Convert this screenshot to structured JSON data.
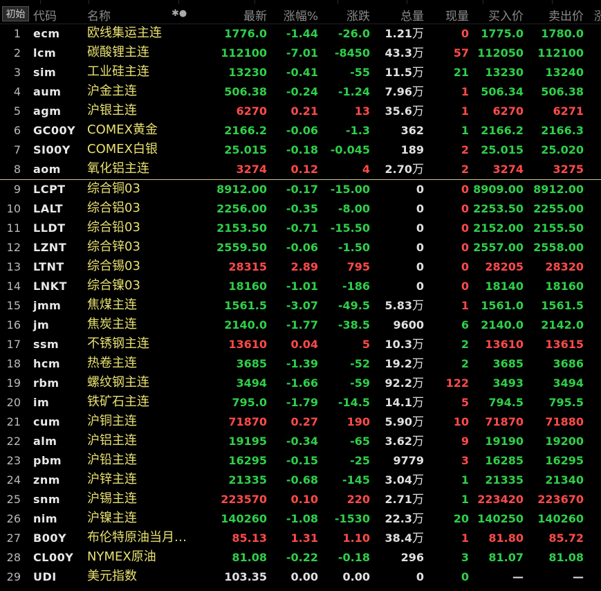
{
  "header": {
    "reset": "初始",
    "code": "代码",
    "name": "名称",
    "settings": "✱●",
    "last": "最新",
    "pct": "涨幅%",
    "chg": "涨跌",
    "vol": "总量",
    "cur": "现量",
    "bid": "买入价",
    "ask": "卖出价",
    "more": "涨"
  },
  "rows": [
    {
      "idx": "1",
      "code": "ecm",
      "name": "欧线集运主连",
      "last": "1776.0",
      "pct": "-1.44",
      "chg": "-26.0",
      "vol": "1.21",
      "unit": "万",
      "cur": "0",
      "bid": "1775.0",
      "ask": "1780.0",
      "dir": "down",
      "cur_dir": "up"
    },
    {
      "idx": "2",
      "code": "lcm",
      "name": "碳酸锂主连",
      "last": "112100",
      "pct": "-7.01",
      "chg": "-8450",
      "vol": "43.3",
      "unit": "万",
      "cur": "57",
      "bid": "112050",
      "ask": "112100",
      "dir": "down",
      "cur_dir": "up"
    },
    {
      "idx": "3",
      "code": "sim",
      "name": "工业硅主连",
      "last": "13230",
      "pct": "-0.41",
      "chg": "-55",
      "vol": "11.5",
      "unit": "万",
      "cur": "21",
      "bid": "13230",
      "ask": "13240",
      "dir": "down",
      "cur_dir": "down"
    },
    {
      "idx": "4",
      "code": "aum",
      "name": "沪金主连",
      "last": "506.38",
      "pct": "-0.24",
      "chg": "-1.24",
      "vol": "7.96",
      "unit": "万",
      "cur": "1",
      "bid": "506.34",
      "ask": "506.38",
      "dir": "down",
      "cur_dir": "up"
    },
    {
      "idx": "5",
      "code": "agm",
      "name": "沪银主连",
      "last": "6270",
      "pct": "0.21",
      "chg": "13",
      "vol": "35.6",
      "unit": "万",
      "cur": "1",
      "bid": "6270",
      "ask": "6271",
      "dir": "up",
      "cur_dir": "up"
    },
    {
      "idx": "6",
      "code": "GC00Y",
      "name": "COMEX黄金",
      "last": "2166.2",
      "pct": "-0.06",
      "chg": "-1.3",
      "vol": "362",
      "unit": "",
      "cur": "1",
      "bid": "2166.2",
      "ask": "2166.3",
      "dir": "down",
      "cur_dir": "down"
    },
    {
      "idx": "7",
      "code": "SI00Y",
      "name": "COMEX白银",
      "last": "25.015",
      "pct": "-0.18",
      "chg": "-0.045",
      "vol": "189",
      "unit": "",
      "cur": "2",
      "bid": "25.015",
      "ask": "25.020",
      "dir": "down",
      "cur_dir": "up"
    },
    {
      "idx": "8",
      "code": "aom",
      "name": "氧化铝主连",
      "last": "3274",
      "pct": "0.12",
      "chg": "4",
      "vol": "2.70",
      "unit": "万",
      "cur": "2",
      "bid": "3274",
      "ask": "3275",
      "dir": "up",
      "cur_dir": "up"
    },
    {
      "idx": "9",
      "code": "LCPT",
      "name": "综合铜03",
      "last": "8912.00",
      "pct": "-0.17",
      "chg": "-15.00",
      "vol": "0",
      "unit": "",
      "cur": "0",
      "bid": "8909.00",
      "ask": "8912.00",
      "dir": "down",
      "cur_dir": "up"
    },
    {
      "idx": "10",
      "code": "LALT",
      "name": "综合铝03",
      "last": "2256.00",
      "pct": "-0.35",
      "chg": "-8.00",
      "vol": "0",
      "unit": "",
      "cur": "0",
      "bid": "2253.50",
      "ask": "2255.00",
      "dir": "down",
      "cur_dir": "up"
    },
    {
      "idx": "11",
      "code": "LLDT",
      "name": "综合铅03",
      "last": "2153.50",
      "pct": "-0.71",
      "chg": "-15.50",
      "vol": "0",
      "unit": "",
      "cur": "0",
      "bid": "2152.00",
      "ask": "2155.50",
      "dir": "down",
      "cur_dir": "up"
    },
    {
      "idx": "12",
      "code": "LZNT",
      "name": "综合锌03",
      "last": "2559.50",
      "pct": "-0.06",
      "chg": "-1.50",
      "vol": "0",
      "unit": "",
      "cur": "0",
      "bid": "2557.00",
      "ask": "2558.00",
      "dir": "down",
      "cur_dir": "up"
    },
    {
      "idx": "13",
      "code": "LTNT",
      "name": "综合锡03",
      "last": "28315",
      "pct": "2.89",
      "chg": "795",
      "vol": "0",
      "unit": "",
      "cur": "0",
      "bid": "28205",
      "ask": "28320",
      "dir": "up",
      "cur_dir": "up"
    },
    {
      "idx": "14",
      "code": "LNKT",
      "name": "综合镍03",
      "last": "18160",
      "pct": "-1.01",
      "chg": "-186",
      "vol": "0",
      "unit": "",
      "cur": "0",
      "bid": "18140",
      "ask": "18160",
      "dir": "down",
      "cur_dir": "up"
    },
    {
      "idx": "15",
      "code": "jmm",
      "name": "焦煤主连",
      "last": "1561.5",
      "pct": "-3.07",
      "chg": "-49.5",
      "vol": "5.83",
      "unit": "万",
      "cur": "1",
      "bid": "1561.0",
      "ask": "1561.5",
      "dir": "down",
      "cur_dir": "up"
    },
    {
      "idx": "16",
      "code": "jm",
      "name": "焦炭主连",
      "last": "2140.0",
      "pct": "-1.77",
      "chg": "-38.5",
      "vol": "9600",
      "unit": "",
      "cur": "6",
      "bid": "2140.0",
      "ask": "2142.0",
      "dir": "down",
      "cur_dir": "down"
    },
    {
      "idx": "17",
      "code": "ssm",
      "name": "不锈钢主连",
      "last": "13610",
      "pct": "0.04",
      "chg": "5",
      "vol": "10.3",
      "unit": "万",
      "cur": "2",
      "bid": "13610",
      "ask": "13615",
      "dir": "up",
      "cur_dir": "down"
    },
    {
      "idx": "18",
      "code": "hcm",
      "name": "热卷主连",
      "last": "3685",
      "pct": "-1.39",
      "chg": "-52",
      "vol": "19.2",
      "unit": "万",
      "cur": "2",
      "bid": "3685",
      "ask": "3686",
      "dir": "down",
      "cur_dir": "down"
    },
    {
      "idx": "19",
      "code": "rbm",
      "name": "螺纹钢主连",
      "last": "3494",
      "pct": "-1.66",
      "chg": "-59",
      "vol": "92.2",
      "unit": "万",
      "cur": "122",
      "bid": "3493",
      "ask": "3494",
      "dir": "down",
      "cur_dir": "up"
    },
    {
      "idx": "20",
      "code": "im",
      "name": "铁矿石主连",
      "last": "795.0",
      "pct": "-1.79",
      "chg": "-14.5",
      "vol": "14.1",
      "unit": "万",
      "cur": "5",
      "bid": "794.5",
      "ask": "795.5",
      "dir": "down",
      "cur_dir": "up"
    },
    {
      "idx": "21",
      "code": "cum",
      "name": "沪铜主连",
      "last": "71870",
      "pct": "0.27",
      "chg": "190",
      "vol": "5.90",
      "unit": "万",
      "cur": "10",
      "bid": "71870",
      "ask": "71880",
      "dir": "up",
      "cur_dir": "up"
    },
    {
      "idx": "22",
      "code": "alm",
      "name": "沪铝主连",
      "last": "19195",
      "pct": "-0.34",
      "chg": "-65",
      "vol": "3.62",
      "unit": "万",
      "cur": "9",
      "bid": "19190",
      "ask": "19200",
      "dir": "down",
      "cur_dir": "up"
    },
    {
      "idx": "23",
      "code": "pbm",
      "name": "沪铅主连",
      "last": "16295",
      "pct": "-0.15",
      "chg": "-25",
      "vol": "9779",
      "unit": "",
      "cur": "3",
      "bid": "16285",
      "ask": "16295",
      "dir": "down",
      "cur_dir": "up"
    },
    {
      "idx": "24",
      "code": "znm",
      "name": "沪锌主连",
      "last": "21335",
      "pct": "-0.68",
      "chg": "-145",
      "vol": "3.04",
      "unit": "万",
      "cur": "1",
      "bid": "21335",
      "ask": "21340",
      "dir": "down",
      "cur_dir": "down"
    },
    {
      "idx": "25",
      "code": "snm",
      "name": "沪锡主连",
      "last": "223570",
      "pct": "0.10",
      "chg": "220",
      "vol": "2.71",
      "unit": "万",
      "cur": "1",
      "bid": "223420",
      "ask": "223670",
      "dir": "up",
      "cur_dir": "down"
    },
    {
      "idx": "26",
      "code": "nim",
      "name": "沪镍主连",
      "last": "140260",
      "pct": "-1.08",
      "chg": "-1530",
      "vol": "22.3",
      "unit": "万",
      "cur": "20",
      "bid": "140250",
      "ask": "140260",
      "dir": "down",
      "cur_dir": "down"
    },
    {
      "idx": "27",
      "code": "B00Y",
      "name": "布伦特原油当月…",
      "last": "85.13",
      "pct": "1.31",
      "chg": "1.10",
      "vol": "38.4",
      "unit": "万",
      "cur": "1",
      "bid": "81.80",
      "ask": "85.72",
      "dir": "up",
      "cur_dir": "up"
    },
    {
      "idx": "28",
      "code": "CL00Y",
      "name": "NYMEX原油",
      "last": "81.08",
      "pct": "-0.22",
      "chg": "-0.18",
      "vol": "296",
      "unit": "",
      "cur": "3",
      "bid": "81.07",
      "ask": "81.08",
      "dir": "down",
      "cur_dir": "down"
    },
    {
      "idx": "29",
      "code": "UDI",
      "name": "美元指数",
      "last": "103.35",
      "pct": "0.00",
      "chg": "0.00",
      "vol": "0",
      "unit": "",
      "cur": "0",
      "bid": "—",
      "ask": "—",
      "dir": "flat",
      "cur_dir": "down"
    }
  ],
  "colors": {
    "up": "#ff4a4a",
    "down": "#2ecf4a",
    "name": "#e8e070",
    "background": "#000000"
  }
}
